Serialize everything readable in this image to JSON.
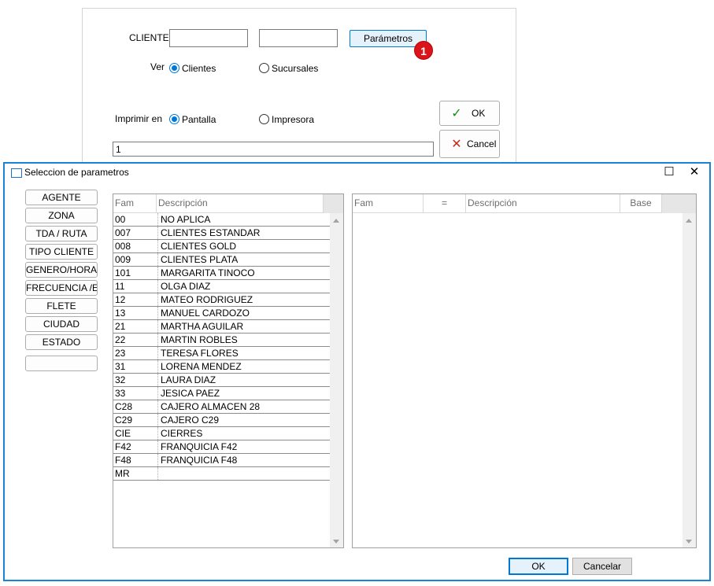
{
  "form": {
    "cliente_label": "CLIENTE",
    "cliente_value_1": "",
    "cliente_value_2": "",
    "parametros_button": "Parámetros",
    "badge": "1",
    "ver_label": "Ver",
    "ver_options": [
      "Clientes",
      "Sucursales"
    ],
    "ver_selected": "Clientes",
    "imprimir_label": "Imprimir en",
    "imprimir_options": [
      "Pantalla",
      "Impresora"
    ],
    "imprimir_selected": "Pantalla",
    "copies_value": "1",
    "ok_label": "OK",
    "cancel_label": "Cancel"
  },
  "dialog": {
    "title": "Seleccion de parametros",
    "categories": [
      "AGENTE",
      "ZONA",
      "TDA / RUTA",
      "TIPO CLIENTE",
      "GENERO/HORARIO",
      "FRECUENCIA /EDAD",
      "FLETE",
      "CIUDAD",
      "ESTADO",
      ""
    ],
    "left_grid": {
      "columns": [
        "Fam",
        "Descripción"
      ],
      "rows": [
        [
          "00",
          "NO APLICA"
        ],
        [
          "007",
          "CLIENTES ESTANDAR"
        ],
        [
          "008",
          "CLIENTES GOLD"
        ],
        [
          "009",
          "CLIENTES PLATA"
        ],
        [
          "101",
          "MARGARITA TINOCO"
        ],
        [
          "11",
          "OLGA DIAZ"
        ],
        [
          "12",
          "MATEO RODRIGUEZ"
        ],
        [
          "13",
          "MANUEL CARDOZO"
        ],
        [
          "21",
          "MARTHA AGUILAR"
        ],
        [
          "22",
          "MARTIN ROBLES"
        ],
        [
          "23",
          "TERESA FLORES"
        ],
        [
          "31",
          "LORENA MENDEZ"
        ],
        [
          "32",
          "LAURA DIAZ"
        ],
        [
          "33",
          "JESICA PAEZ"
        ],
        [
          "C28",
          "CAJERO ALMACEN 28"
        ],
        [
          "C29",
          "CAJERO C29"
        ],
        [
          "CIE",
          "CIERRES"
        ],
        [
          "F42",
          "FRANQUICIA F42"
        ],
        [
          "F48",
          "FRANQUICIA F48"
        ],
        [
          "MR",
          ""
        ]
      ]
    },
    "right_grid": {
      "columns": [
        "Fam",
        "=",
        "Descripción",
        "Base"
      ],
      "rows": []
    },
    "ok_label": "OK",
    "cancel_label": "Cancelar"
  },
  "icons": {
    "check": "check-icon",
    "cross": "x-icon",
    "maximize": "maximize-icon",
    "close": "close-icon",
    "window": "window-icon"
  },
  "colors": {
    "accent": "#0078d7",
    "dialog_border": "#1883d7",
    "badge": "#d9141b",
    "check": "#1a8a1a",
    "cross": "#c42b1c"
  }
}
